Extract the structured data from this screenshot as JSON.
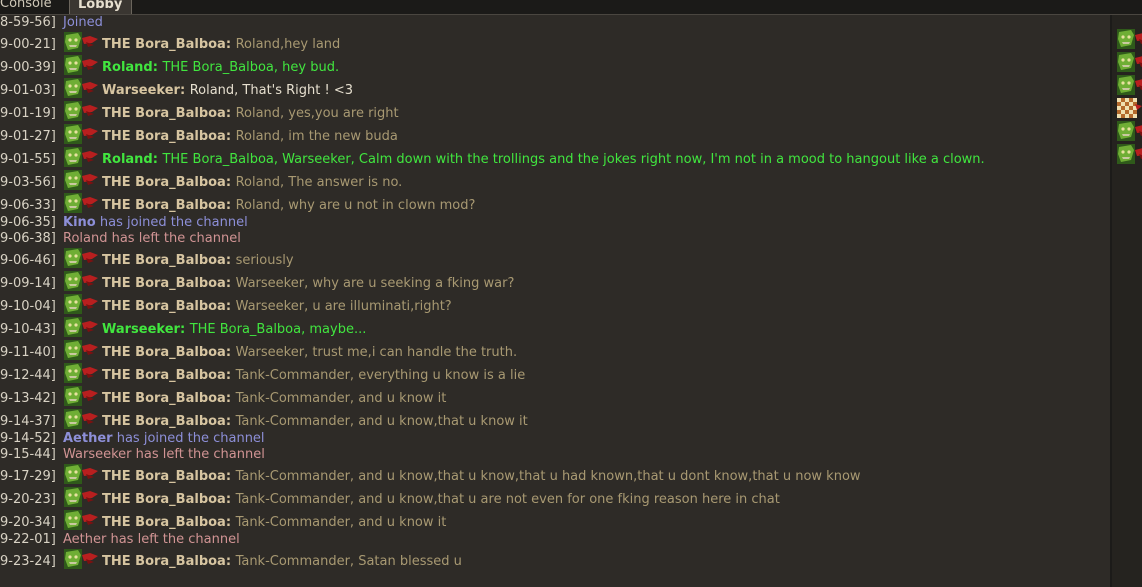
{
  "tabs": [
    {
      "label": "Console"
    },
    {
      "label": "Lobby"
    }
  ],
  "messages": [
    {
      "type": "sys",
      "ts": "8-59-56]",
      "text": "Joined",
      "color": "join"
    },
    {
      "type": "msg",
      "ts": "9-00-21]",
      "name": "THE Bora_Balboa:",
      "text": "Roland,hey land",
      "color": "bora"
    },
    {
      "type": "msg",
      "ts": "9-00-39]",
      "name": "Roland:",
      "text": "THE Bora_Balboa, hey bud.",
      "color": "green"
    },
    {
      "type": "msg",
      "ts": "9-01-03]",
      "name": "Warseeker:",
      "text": "Roland, That's Right ! <3",
      "color": "warseeker"
    },
    {
      "type": "msg",
      "ts": "9-01-19]",
      "name": "THE Bora_Balboa:",
      "text": "Roland, yes,you are right",
      "color": "bora"
    },
    {
      "type": "msg",
      "ts": "9-01-27]",
      "name": "THE Bora_Balboa:",
      "text": "Roland, im the new buda",
      "color": "bora"
    },
    {
      "type": "msg",
      "ts": "9-01-55]",
      "name": "Roland:",
      "text": "THE Bora_Balboa, Warseeker, Calm down with the trollings and the jokes right now, I'm not in a mood to hangout like a clown.",
      "color": "green"
    },
    {
      "type": "msg",
      "ts": "9-03-56]",
      "name": "THE Bora_Balboa:",
      "text": "Roland, The answer is no.",
      "color": "bora"
    },
    {
      "type": "msg",
      "ts": "9-06-33]",
      "name": "THE Bora_Balboa:",
      "text": "Roland, why are u not in clown mod?",
      "color": "bora"
    },
    {
      "type": "joinmsg",
      "ts": "9-06-35]",
      "name": "Kino",
      "text": "has joined the channel",
      "color": "join"
    },
    {
      "type": "sys",
      "ts": "9-06-38]",
      "text": "Roland has left the channel",
      "color": "left"
    },
    {
      "type": "msg",
      "ts": "9-06-46]",
      "name": "THE Bora_Balboa:",
      "text": "seriously",
      "color": "bora"
    },
    {
      "type": "msg",
      "ts": "9-09-14]",
      "name": "THE Bora_Balboa:",
      "text": "Warseeker, why are u seeking a fking war?",
      "color": "bora"
    },
    {
      "type": "msg",
      "ts": "9-10-04]",
      "name": "THE Bora_Balboa:",
      "text": "Warseeker, u are illuminati,right?",
      "color": "bora"
    },
    {
      "type": "msg",
      "ts": "9-10-43]",
      "name": "Warseeker:",
      "text": "THE Bora_Balboa, maybe...",
      "color": "green"
    },
    {
      "type": "msg",
      "ts": "9-11-40]",
      "name": "THE Bora_Balboa:",
      "text": "Warseeker, trust me,i can handle the truth.",
      "color": "bora"
    },
    {
      "type": "msg",
      "ts": "9-12-44]",
      "name": "THE Bora_Balboa:",
      "text": "Tank-Commander, everything u know is a lie",
      "color": "bora"
    },
    {
      "type": "msg",
      "ts": "9-13-42]",
      "name": "THE Bora_Balboa:",
      "text": "Tank-Commander, and u know it",
      "color": "bora"
    },
    {
      "type": "msg",
      "ts": "9-14-37]",
      "name": "THE Bora_Balboa:",
      "text": "Tank-Commander, and u know,that u know it",
      "color": "bora"
    },
    {
      "type": "joinmsg",
      "ts": "9-14-52]",
      "name": "Aether",
      "text": "has joined the channel",
      "color": "join"
    },
    {
      "type": "sys",
      "ts": "9-15-44]",
      "text": "Warseeker has left the channel",
      "color": "left"
    },
    {
      "type": "msg",
      "ts": "9-17-29]",
      "name": "THE Bora_Balboa:",
      "text": "Tank-Commander, and u know,that u know,that u had known,that u dont know,that u now know",
      "color": "bora"
    },
    {
      "type": "msg",
      "ts": "9-20-23]",
      "name": "THE Bora_Balboa:",
      "text": "Tank-Commander, and u know,that u are not even for one fking reason here in chat",
      "color": "bora"
    },
    {
      "type": "msg",
      "ts": "9-20-34]",
      "name": "THE Bora_Balboa:",
      "text": "Tank-Commander, and u know it",
      "color": "bora"
    },
    {
      "type": "sys",
      "ts": "9-22-01]",
      "text": "Aether has left the channel",
      "color": "left"
    },
    {
      "type": "msg",
      "ts": "9-23-24]",
      "name": "THE Bora_Balboa:",
      "text": "Tank-Commander, Satan blessed u",
      "color": "bora"
    }
  ],
  "userlist": [
    {
      "icon": "orc-avatar-icon"
    },
    {
      "icon": "orc-avatar-icon"
    },
    {
      "icon": "orc-avatar-icon"
    },
    {
      "icon": "checkered-avatar-icon"
    },
    {
      "icon": "orc-avatar-icon"
    },
    {
      "icon": "orc-avatar-icon"
    }
  ],
  "colors": {
    "bora_name": "#d7c5a1",
    "bora_msg": "#a89972",
    "green": "#41e63f",
    "join": "#8d8fd8",
    "left": "#d19494",
    "background": "#2e2b27"
  }
}
